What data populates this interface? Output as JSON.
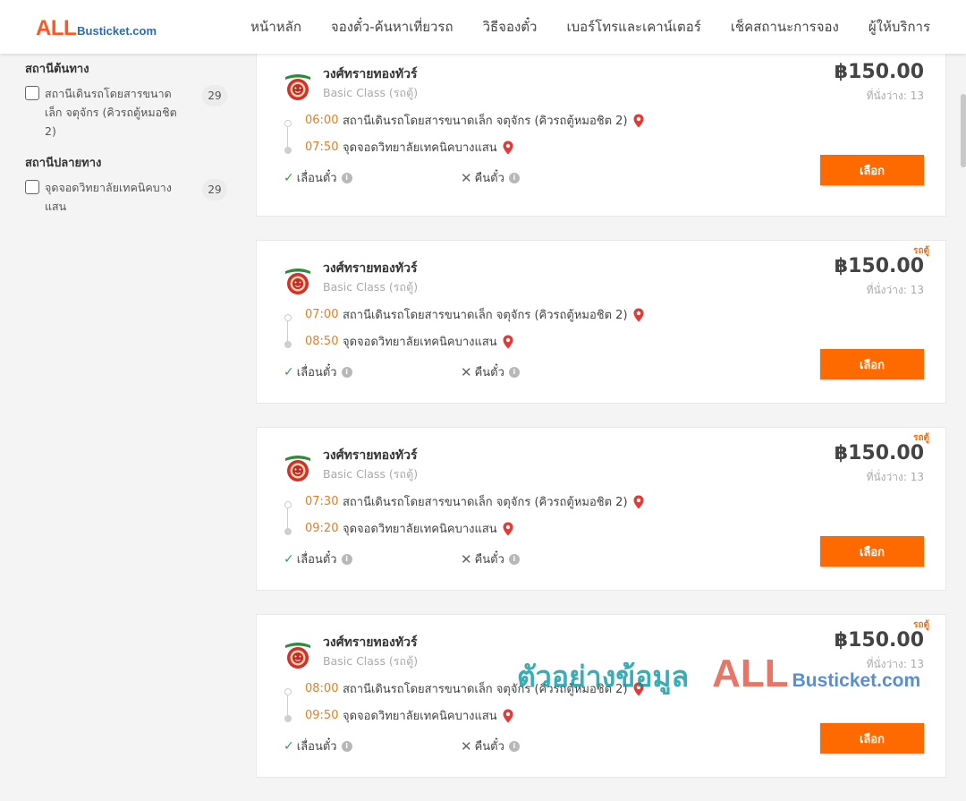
{
  "header": {
    "logo_all": "ALL",
    "logo_rest": "Busticket.com",
    "nav": [
      "หน้าหลัก",
      "จองตั๋ว-ค้นหาเที่ยวรถ",
      "วิธีจองตั๋ว",
      "เบอร์โทรและเคาน์เตอร์",
      "เช็คสถานะการจอง",
      "ผู้ให้บริการ"
    ]
  },
  "sidebar": {
    "origin_title": "สถานีต้นทาง",
    "origin_label": "สถานีเดินรถโดยสารขนาดเล็ก จตุจักร (คิวรถตู้หมอชิต 2)",
    "origin_count": "29",
    "dest_title": "สถานีปลายทาง",
    "dest_label": "จุดจอดวิทยาลัยเทคนิคบางแสน",
    "dest_count": "29"
  },
  "trips": [
    {
      "tag": "",
      "operator": "วงศ์ทรายทองทัวร์",
      "class": "Basic Class (รถตู้)",
      "price": "฿150.00",
      "seats": "ที่นั่งว่าง: 13",
      "dep_time": "06:00",
      "dep_station": "สถานีเดินรถโดยสารขนาดเล็ก จตุจักร (คิวรถตู้หมอชิต 2)",
      "arr_time": "07:50",
      "arr_station": "จุดจอดวิทยาลัยเทคนิคบางแสน",
      "change": "เลื่อนตั๋ว",
      "refund": "คืนตั๋ว",
      "button": "เลือก"
    },
    {
      "tag": "รถตู้",
      "operator": "วงศ์ทรายทองทัวร์",
      "class": "Basic Class (รถตู้)",
      "price": "฿150.00",
      "seats": "ที่นั่งว่าง: 13",
      "dep_time": "07:00",
      "dep_station": "สถานีเดินรถโดยสารขนาดเล็ก จตุจักร (คิวรถตู้หมอชิต 2)",
      "arr_time": "08:50",
      "arr_station": "จุดจอดวิทยาลัยเทคนิคบางแสน",
      "change": "เลื่อนตั๋ว",
      "refund": "คืนตั๋ว",
      "button": "เลือก"
    },
    {
      "tag": "รถตู้",
      "operator": "วงศ์ทรายทองทัวร์",
      "class": "Basic Class (รถตู้)",
      "price": "฿150.00",
      "seats": "ที่นั่งว่าง: 13",
      "dep_time": "07:30",
      "dep_station": "สถานีเดินรถโดยสารขนาดเล็ก จตุจักร (คิวรถตู้หมอชิต 2)",
      "arr_time": "09:20",
      "arr_station": "จุดจอดวิทยาลัยเทคนิคบางแสน",
      "change": "เลื่อนตั๋ว",
      "refund": "คืนตั๋ว",
      "button": "เลือก"
    },
    {
      "tag": "รถตู้",
      "operator": "วงศ์ทรายทองทัวร์",
      "class": "Basic Class (รถตู้)",
      "price": "฿150.00",
      "seats": "ที่นั่งว่าง: 13",
      "dep_time": "08:00",
      "dep_station": "สถานีเดินรถโดยสารขนาดเล็ก จตุจักร (คิวรถตู้หมอชิต 2)",
      "arr_time": "09:50",
      "arr_station": "จุดจอดวิทยาลัยเทคนิคบางแสน",
      "change": "เลื่อนตั๋ว",
      "refund": "คืนตั๋ว",
      "button": "เลือก"
    }
  ],
  "watermark": {
    "text": "ตัวอย่างข้อมูล",
    "all": "ALL",
    "rest": "Busticket.com"
  },
  "colors": {
    "accent": "#ff6a00",
    "time": "#e67e22",
    "pin": "#e53935",
    "check": "#3aa04a"
  },
  "icons": {
    "pin": "map-pin-icon",
    "check": "check-icon",
    "x": "x-icon",
    "info": "info-icon",
    "operator": "operator-logo-icon"
  }
}
